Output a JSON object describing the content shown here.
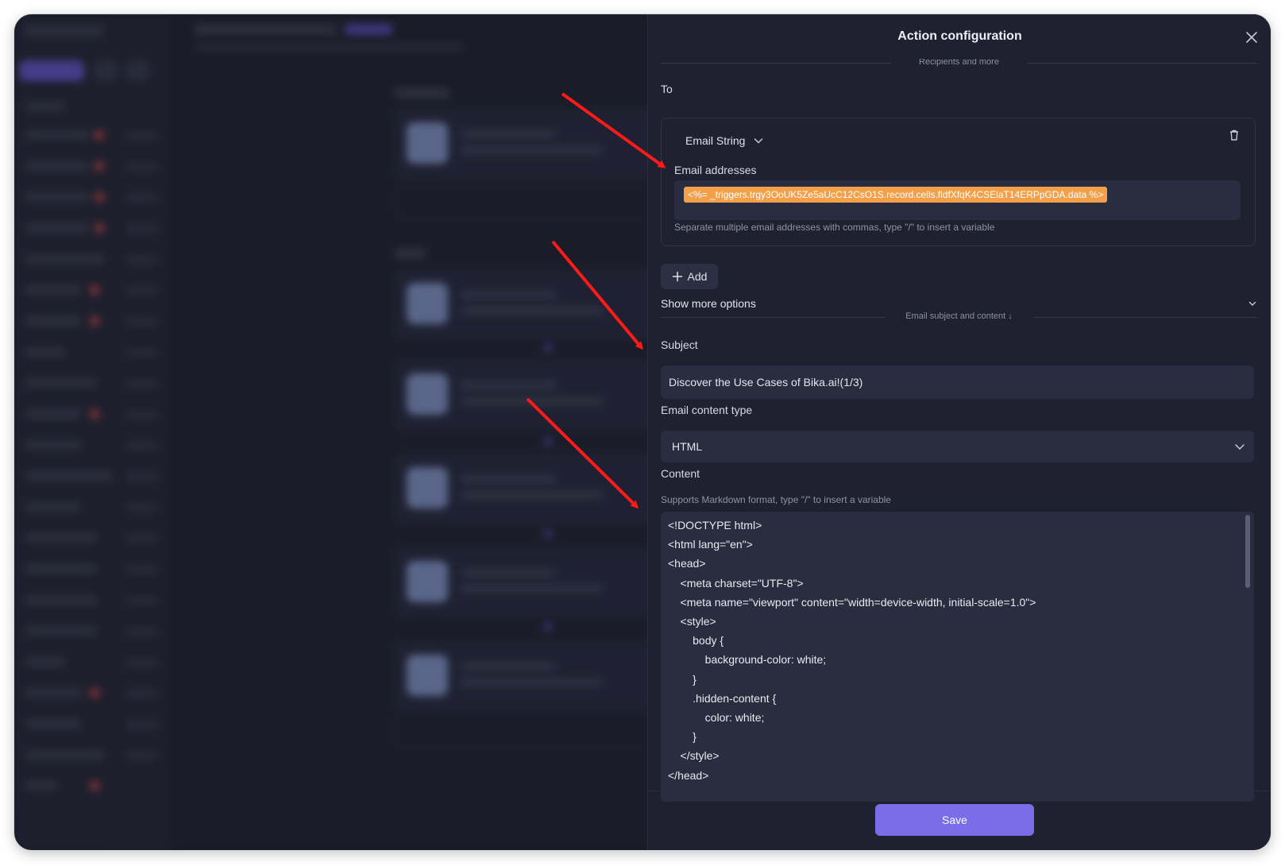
{
  "drawer": {
    "title": "Action configuration",
    "close_icon": "close-icon"
  },
  "recipients": {
    "section_label": "Recipients and more",
    "to_label": "To",
    "type_select": "Email String",
    "email_label": "Email addresses",
    "email_variable": "<%= _triggers.trgy3OoUK5Ze5aUcC12CsO1S.record.cells.fldfXfqK4CSElaT14ERPpGDA.data %>",
    "email_hint": "Separate multiple email addresses with commas, type \"/\" to insert a variable",
    "add_label": "Add"
  },
  "more_options": {
    "label": "Show more options"
  },
  "content_section": {
    "section_label": "Email subject and content ↓",
    "subject_label": "Subject",
    "subject_value": "Discover the Use Cases of Bika.ai!(1/3)",
    "content_type_label": "Email content type",
    "content_type_value": "HTML",
    "content_label": "Content",
    "content_hint": "Supports Markdown format, type \"/\" to insert a variable",
    "code_lines": [
      "<!DOCTYPE html>",
      "<html lang=\"en\">",
      "<head>",
      "    <meta charset=\"UTF-8\">",
      "    <meta name=\"viewport\" content=\"width=device-width, initial-scale=1.0\">",
      "    <style>",
      "        body {",
      "            background-color: white;",
      "        }",
      "        .hidden-content {",
      "            color: white;",
      "        }",
      "    </style>",
      "</head>"
    ]
  },
  "footer": {
    "save_label": "Save"
  },
  "colors": {
    "accent": "#7b6ce8",
    "variable_chip": "#f4a04a",
    "annotation_arrow": "#ff1a1a"
  }
}
